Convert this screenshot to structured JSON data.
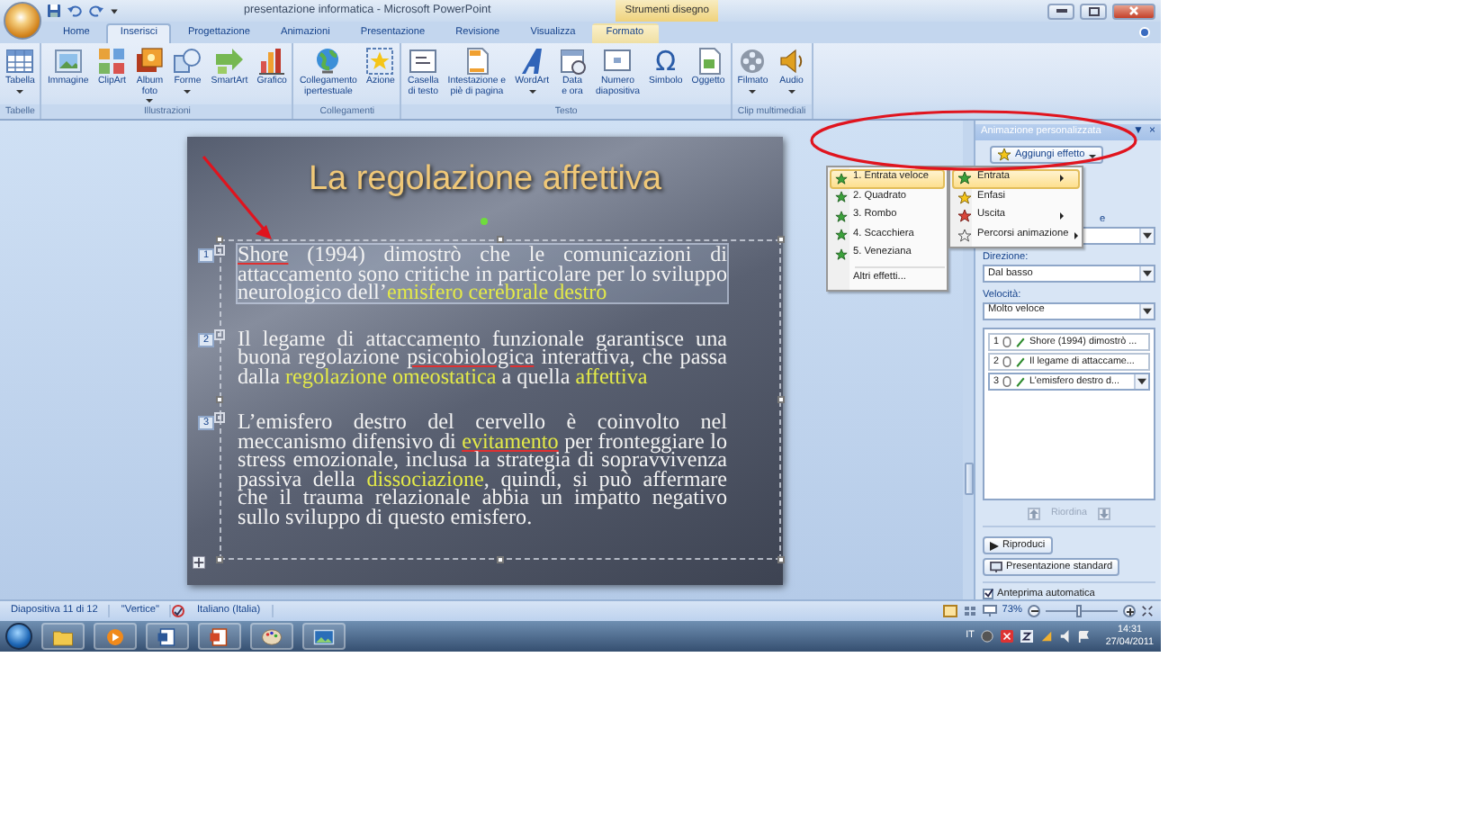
{
  "window": {
    "title": "presentazione informatica - Microsoft PowerPoint",
    "context_label": "Strumenti disegno"
  },
  "tabs": [
    {
      "label": "Home",
      "selected": false,
      "contextual": false
    },
    {
      "label": "Inserisci",
      "selected": true,
      "contextual": false
    },
    {
      "label": "Progettazione",
      "selected": false,
      "contextual": false
    },
    {
      "label": "Animazioni",
      "selected": false,
      "contextual": false
    },
    {
      "label": "Presentazione",
      "selected": false,
      "contextual": false
    },
    {
      "label": "Revisione",
      "selected": false,
      "contextual": false
    },
    {
      "label": "Visualizza",
      "selected": false,
      "contextual": false
    },
    {
      "label": "Formato",
      "selected": false,
      "contextual": true
    }
  ],
  "ribbon_groups": [
    {
      "label": "Tabelle",
      "buttons": [
        {
          "label": [
            "Tabella"
          ],
          "dropdown": true
        }
      ]
    },
    {
      "label": "Illustrazioni",
      "buttons": [
        {
          "label": [
            "Immagine"
          ],
          "dropdown": false
        },
        {
          "label": [
            "ClipArt"
          ],
          "dropdown": false
        },
        {
          "label": [
            "Album",
            "foto"
          ],
          "dropdown": true
        },
        {
          "label": [
            "Forme"
          ],
          "dropdown": true
        },
        {
          "label": [
            "SmartArt"
          ],
          "dropdown": false
        },
        {
          "label": [
            "Grafico"
          ],
          "dropdown": false
        }
      ]
    },
    {
      "label": "Collegamenti",
      "buttons": [
        {
          "label": [
            "Collegamento",
            "ipertestuale"
          ],
          "dropdown": false
        },
        {
          "label": [
            "Azione"
          ],
          "dropdown": false
        }
      ]
    },
    {
      "label": "Testo",
      "buttons": [
        {
          "label": [
            "Casella",
            "di testo"
          ],
          "dropdown": false
        },
        {
          "label": [
            "Intestazione e",
            "piè di pagina"
          ],
          "dropdown": false
        },
        {
          "label": [
            "WordArt"
          ],
          "dropdown": true
        },
        {
          "label": [
            "Data",
            "e ora"
          ],
          "dropdown": false
        },
        {
          "label": [
            "Numero",
            "diapositiva"
          ],
          "dropdown": false
        },
        {
          "label": [
            "Simbolo"
          ],
          "dropdown": false,
          "glyph": "Ω"
        },
        {
          "label": [
            "Oggetto"
          ],
          "dropdown": false
        }
      ]
    },
    {
      "label": "Clip multimediali",
      "buttons": [
        {
          "label": [
            "Filmato"
          ],
          "dropdown": true
        },
        {
          "label": [
            "Audio"
          ],
          "dropdown": true
        }
      ]
    }
  ],
  "slide": {
    "title": "La regolazione affettiva",
    "paragraphs": [
      {
        "number": "1",
        "selected": true,
        "segments": [
          {
            "text": "Shore",
            "kind": "misspelled"
          },
          {
            "text": " (1994) dimostrò che le comunicazioni di attaccamento sono critiche in particolare per lo sviluppo neurologico dell’",
            "kind": "plain"
          },
          {
            "text": "emisfero cerebrale destro",
            "kind": "highlighted"
          }
        ]
      },
      {
        "number": "2",
        "selected": false,
        "segments": [
          {
            "text": "Il legame di attaccamento funzionale garantisce una buona regolazione ",
            "kind": "plain"
          },
          {
            "text": "psicobiologica",
            "kind": "misspelled"
          },
          {
            "text": " interattiva, che passa dalla ",
            "kind": "plain"
          },
          {
            "text": "regolazione omeostatica",
            "kind": "highlighted"
          },
          {
            "text": " a quella ",
            "kind": "plain"
          },
          {
            "text": "affettiva",
            "kind": "highlighted"
          }
        ]
      },
      {
        "number": "3",
        "selected": false,
        "segments": [
          {
            "text": "L’emisfero destro del cervello è coinvolto nel meccanismo difensivo di ",
            "kind": "plain"
          },
          {
            "text": "evitamento",
            "kind": "highlighted-misspelled"
          },
          {
            "text": " per fronteggiare lo stress emozionale, inclusa la strategia di sopravvivenza passiva della ",
            "kind": "plain"
          },
          {
            "text": "dissociazione",
            "kind": "highlighted"
          },
          {
            "text": ", quindi, si può affermare che il trauma relazionale abbia un impatto negativo sullo sviluppo di questo emisfero.",
            "kind": "plain"
          }
        ]
      }
    ]
  },
  "effect_menu": [
    {
      "label": "1. Entrata veloce",
      "selected": true,
      "kind": "effect"
    },
    {
      "label": "2. Quadrato",
      "selected": false,
      "kind": "effect"
    },
    {
      "label": "3. Rombo",
      "selected": false,
      "kind": "effect"
    },
    {
      "label": "4. Scacchiera",
      "selected": false,
      "kind": "effect"
    },
    {
      "label": "5. Veneziana",
      "selected": false,
      "kind": "effect"
    },
    {
      "label": "Altri effetti...",
      "selected": false,
      "kind": "more"
    }
  ],
  "category_menu": [
    {
      "label": "Entrata",
      "selected": true,
      "submenu": true
    },
    {
      "label": "Enfasi",
      "selected": false,
      "submenu": false
    },
    {
      "label": "Uscita",
      "selected": false,
      "submenu": true
    },
    {
      "label": "Percorsi animazione",
      "selected": false,
      "submenu": true
    }
  ],
  "task_pane": {
    "title": "Animazione personalizzata",
    "title_buttons": [
      "▼",
      "×"
    ],
    "add_button": "Aggiungi effetto",
    "fields": [
      {
        "kind": "cut",
        "label": "e"
      },
      {
        "kind": "labeled",
        "label": "Direzione:",
        "value": "Dal basso"
      },
      {
        "kind": "labeled",
        "label": "Velocità:",
        "value": "Molto veloce"
      }
    ],
    "animation_list": [
      {
        "number": "1",
        "text": "Shore (1994) dimostrò ...",
        "selected": false
      },
      {
        "number": "2",
        "text": "Il legame di attaccame...",
        "selected": false
      },
      {
        "number": "3",
        "text": "L’emisfero destro d...",
        "selected": true
      }
    ],
    "reorder_label": "Riordina",
    "play_button": "Riproduci",
    "slideshow_button": "Presentazione standard",
    "autopreview": {
      "label": "Anteprima automatica",
      "checked": true
    }
  },
  "status_bar": {
    "slide": "Diapositiva 11 di 12",
    "theme": "\"Vertice\"",
    "language": "Italiano (Italia)",
    "zoom": "73%",
    "zoom_slider": {
      "level": 0.45
    }
  },
  "taskbar": {
    "language": "IT",
    "time": "14:31",
    "date": "27/04/2011"
  }
}
